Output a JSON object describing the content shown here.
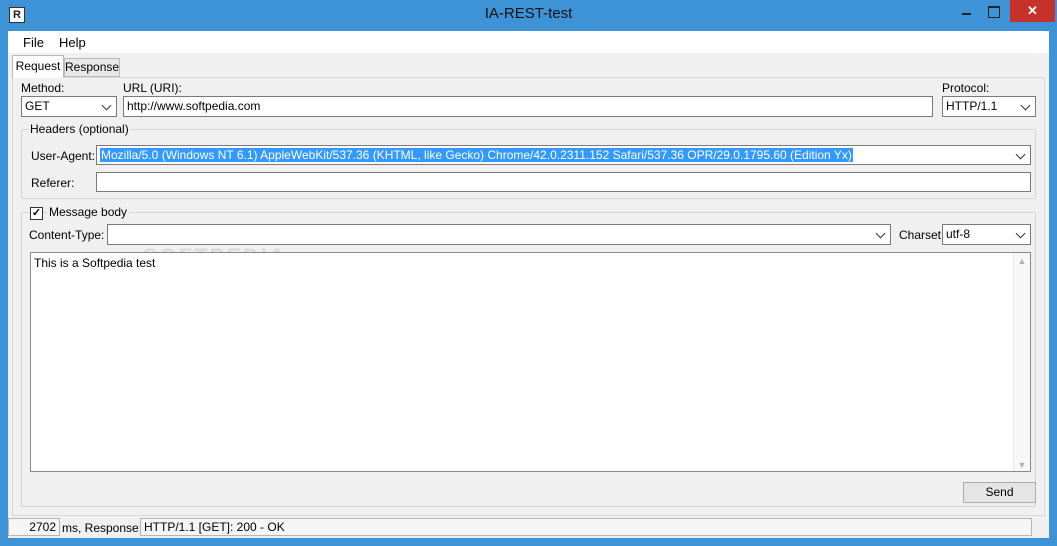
{
  "window": {
    "title": "IA-REST-test",
    "icon_text": "R",
    "close_glyph": "✕"
  },
  "menu": {
    "file": "File",
    "help": "Help"
  },
  "tabs": {
    "request": "Request",
    "response": "Response"
  },
  "request": {
    "method_label": "Method:",
    "method_value": "GET",
    "url_label": "URL (URI):",
    "url_value": "http://www.softpedia.com",
    "protocol_label": "Protocol:",
    "protocol_value": "HTTP/1.1",
    "headers_title": "Headers (optional)",
    "user_agent_label": "User-Agent:",
    "user_agent_value": "Mozilla/5.0 (Windows NT 6.1) AppleWebKit/537.36 (KHTML, like Gecko) Chrome/42.0.2311.152 Safari/537.36 OPR/29.0.1795.60 (Edition Yx)",
    "referer_label": "Referer:",
    "referer_value": "",
    "message_body_label": "Message body",
    "message_body_checked": true,
    "content_type_label": "Content-Type:",
    "content_type_value": "",
    "charset_label": "Charset:",
    "charset_value": "utf-8",
    "body_text": "This is a Softpedia test",
    "watermark": "SOFTPEDIA"
  },
  "actions": {
    "send_label": "Send"
  },
  "status": {
    "elapsed": "2702",
    "elapsed_suffix": "ms, Response:",
    "response": "HTTP/1.1 [GET]: 200 - OK"
  },
  "colors": {
    "titlebar": "#3e93d6",
    "close_button": "#c7312b",
    "selection": "#3399ff"
  }
}
